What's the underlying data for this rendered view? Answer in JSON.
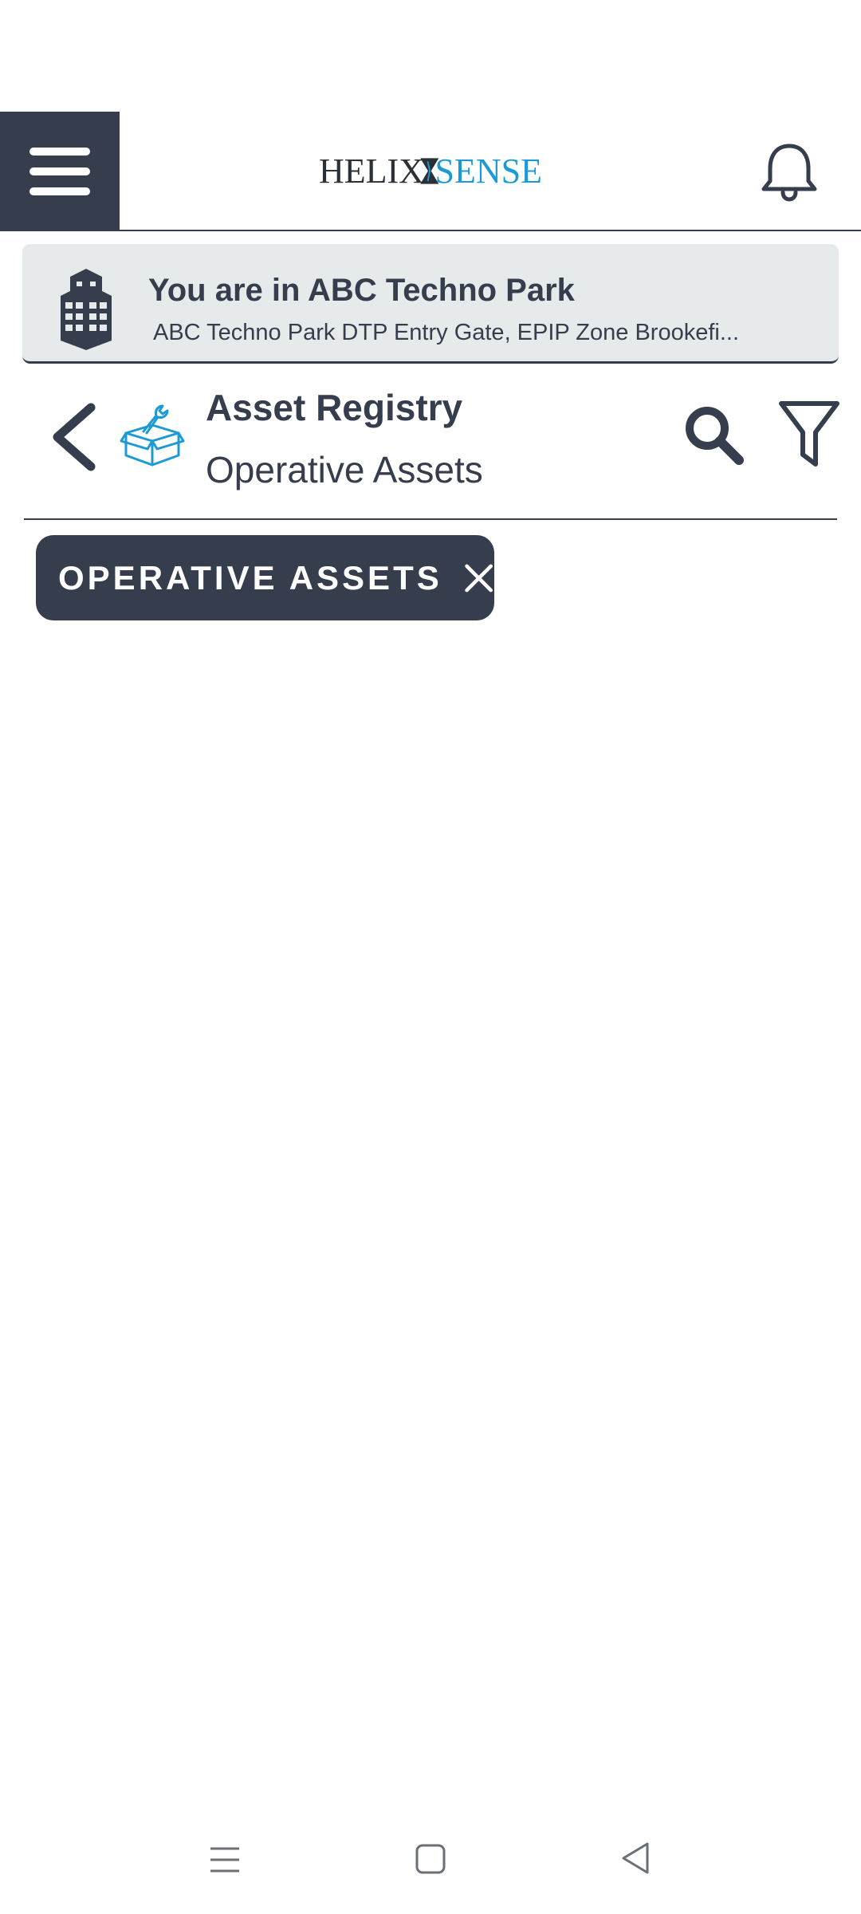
{
  "header": {
    "logo": {
      "left": "HELIX",
      "right": "SENSE"
    },
    "icons": {
      "menu": "hamburger-menu-icon",
      "notifications": "bell-icon"
    }
  },
  "location": {
    "title": "You are in ABC Techno Park",
    "address": "ABC Techno Park DTP Entry Gate, EPIP Zone Brookefi..."
  },
  "page": {
    "title": "Asset Registry",
    "subtitle": "Operative Assets"
  },
  "filters": {
    "chips": [
      {
        "label": "OPERATIVE ASSETS"
      }
    ]
  },
  "colors": {
    "primary": "#363d4c",
    "accent": "#1c9ad6",
    "card_bg": "#e7eaeb",
    "background": "#ffffff"
  }
}
